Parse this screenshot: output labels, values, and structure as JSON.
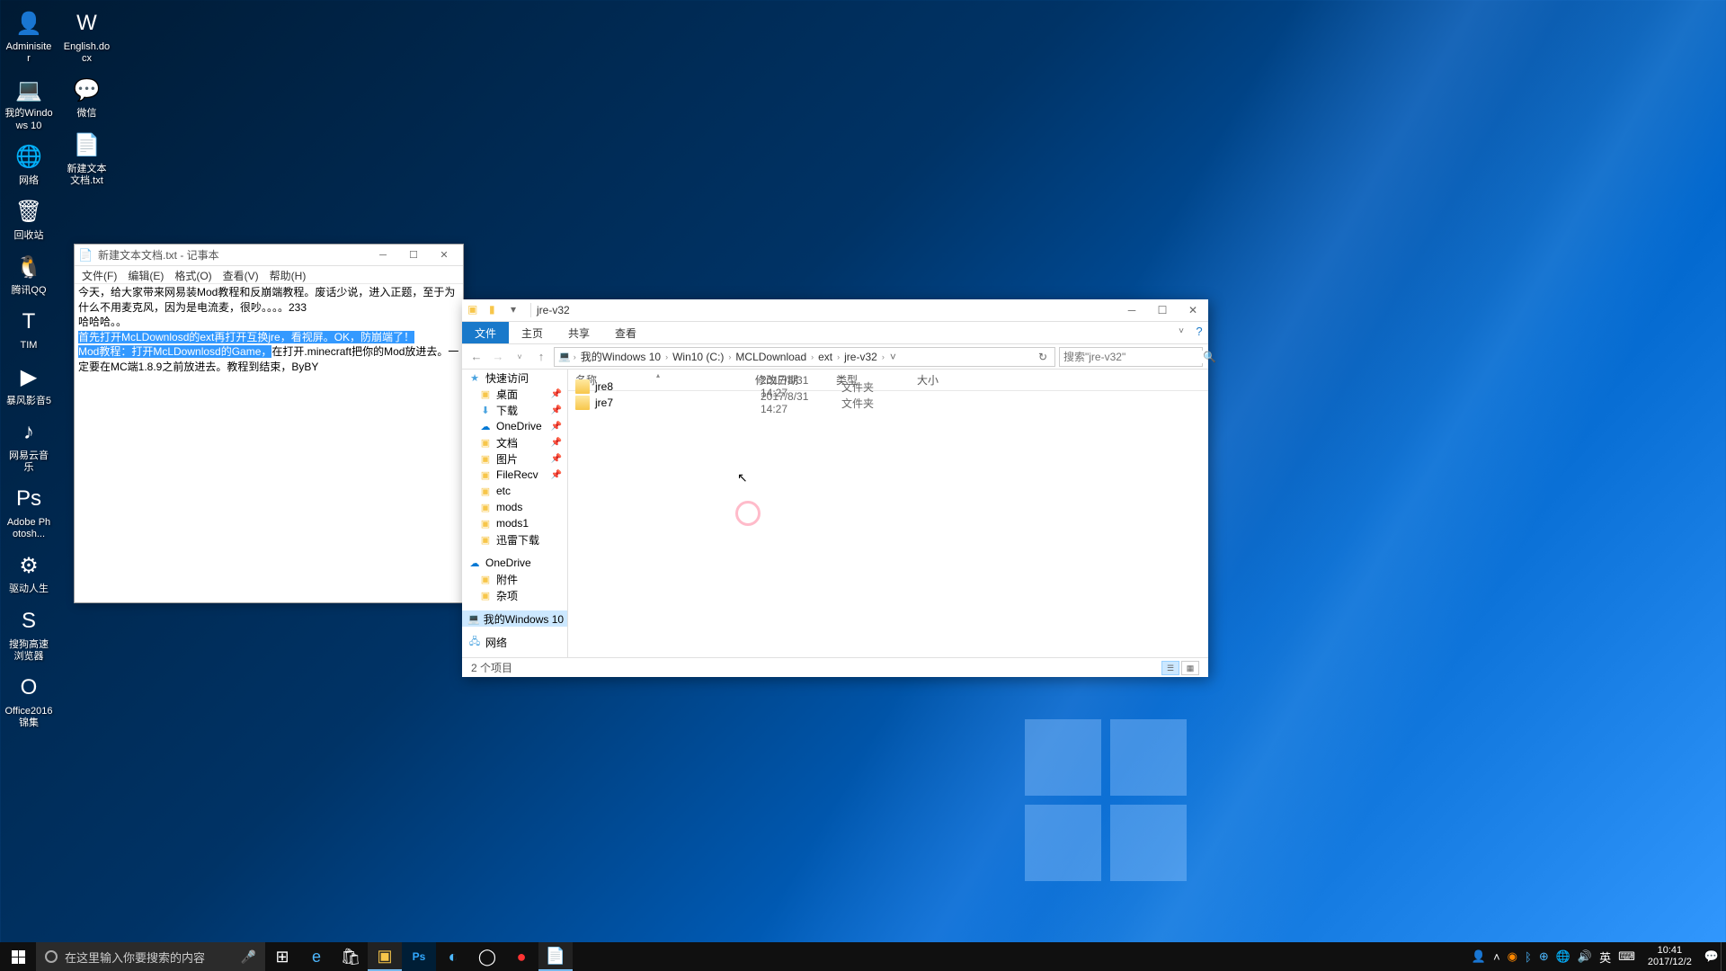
{
  "desktop": {
    "col1": [
      {
        "label": "Adminisiter",
        "icon": "👤"
      },
      {
        "label": "我的Windows 10",
        "icon": "💻"
      },
      {
        "label": "网络",
        "icon": "🌐"
      },
      {
        "label": "回收站",
        "icon": "🗑"
      },
      {
        "label": "腾讯QQ",
        "icon": "🐧"
      },
      {
        "label": "TIM",
        "icon": "T"
      },
      {
        "label": "暴风影音5",
        "icon": "▶"
      },
      {
        "label": "网易云音乐",
        "icon": "♪"
      },
      {
        "label": "Adobe Photosh...",
        "icon": "Ps"
      },
      {
        "label": "驱动人生",
        "icon": "⚙"
      },
      {
        "label": "搜狗高速浏览器",
        "icon": "S"
      },
      {
        "label": "Office2016 锦集",
        "icon": "O"
      }
    ],
    "col2": [
      {
        "label": "English.docx",
        "icon": "W"
      },
      {
        "label": "微信",
        "icon": "💬"
      },
      {
        "label": "新建文本文档.txt",
        "icon": "📄"
      }
    ]
  },
  "notepad": {
    "title": "新建文本文档.txt - 记事本",
    "menu": [
      "文件(F)",
      "编辑(E)",
      "格式(O)",
      "查看(V)",
      "帮助(H)"
    ],
    "line1": "今天，给大家带来网易装Mod教程和反崩端教程。废话少说，进入正题，至于为什么不用麦克风，因为是电流麦，很吵。。。。233",
    "line2": "哈哈哈。。",
    "sel1": "首先打开McLDownlosd的ext再打开互换jre，看视屏。OK，防崩端了！",
    "sel2": "Mod教程：打开McLDownlosd的Game，",
    "line3a": "在打开.minecraft把你的Mod放进去。一定要在MC端1.8.9之前放进去。教程到结束，ByBY"
  },
  "explorer": {
    "title": "jre-v32",
    "ribbon": [
      "文件",
      "主页",
      "共享",
      "查看"
    ],
    "crumbs": [
      "我的Windows 10",
      "Win10 (C:)",
      "MCLDownload",
      "ext",
      "jre-v32"
    ],
    "search_placeholder": "搜索\"jre-v32\"",
    "columns": {
      "name": "名称",
      "date": "修改日期",
      "type": "类型",
      "size": "大小"
    },
    "nav": {
      "quick": "快速访问",
      "items": [
        {
          "label": "桌面",
          "icon": "fold",
          "pin": true
        },
        {
          "label": "下载",
          "icon": "dl",
          "pin": true
        },
        {
          "label": "OneDrive",
          "icon": "cloud",
          "pin": true
        },
        {
          "label": "文档",
          "icon": "fold",
          "pin": true
        },
        {
          "label": "图片",
          "icon": "fold",
          "pin": true
        },
        {
          "label": "FileRecv",
          "icon": "fold",
          "pin": true
        },
        {
          "label": "etc",
          "icon": "fold"
        },
        {
          "label": "mods",
          "icon": "fold"
        },
        {
          "label": "mods1",
          "icon": "fold"
        },
        {
          "label": "迅雷下载",
          "icon": "fold"
        }
      ],
      "onedrive": "OneDrive",
      "od_items": [
        {
          "label": "附件",
          "icon": "fold"
        },
        {
          "label": "杂项",
          "icon": "fold"
        }
      ],
      "pc": "我的Windows 10",
      "network": "网络"
    },
    "files": [
      {
        "name": "jre7",
        "date": "2017/8/31 14:27",
        "type": "文件夹"
      },
      {
        "name": "jre8",
        "date": "2017/8/31 14:27",
        "type": "文件夹"
      }
    ],
    "status": "2 个项目"
  },
  "taskbar": {
    "search": "在这里输入你要搜索的内容",
    "ime": "英",
    "time": "10:41",
    "date": "2017/12/2"
  }
}
